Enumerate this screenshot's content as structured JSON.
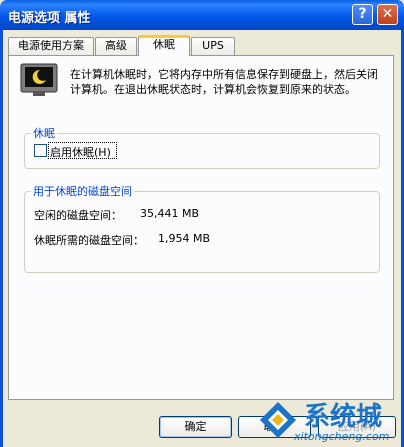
{
  "window": {
    "title": "电源选项 属性"
  },
  "titlebar": {
    "help_label": "?",
    "close_label": "✕"
  },
  "tabs": [
    {
      "label": "电源使用方案"
    },
    {
      "label": "高级"
    },
    {
      "label": "休眠",
      "active": true
    },
    {
      "label": "UPS"
    }
  ],
  "hibernate": {
    "description": "在计算机休眠时，它将内存中所有信息保存到硬盘上，然后关闭计算机。在退出休眠状态时，计算机会恢复到原来的状态。",
    "group_title": "休眠",
    "checkbox_label": "启用休眠(H)",
    "checkbox_checked": false
  },
  "disk_space": {
    "group_title": "用于休眠的磁盘空间",
    "free_label": "空闲的磁盘空间：",
    "free_value": "35,441 MB",
    "required_label": "休眠所需的磁盘空间：",
    "required_value": "1,954 MB"
  },
  "buttons": {
    "ok": "确定",
    "cancel": "取消",
    "apply": "应用(A)"
  },
  "watermark": {
    "name": "系统城",
    "url": "xitongcheng.com"
  },
  "colors": {
    "titlebar": "#0058e6",
    "group_title": "#0046d5",
    "active_tab_accent": "#ffc83c"
  }
}
